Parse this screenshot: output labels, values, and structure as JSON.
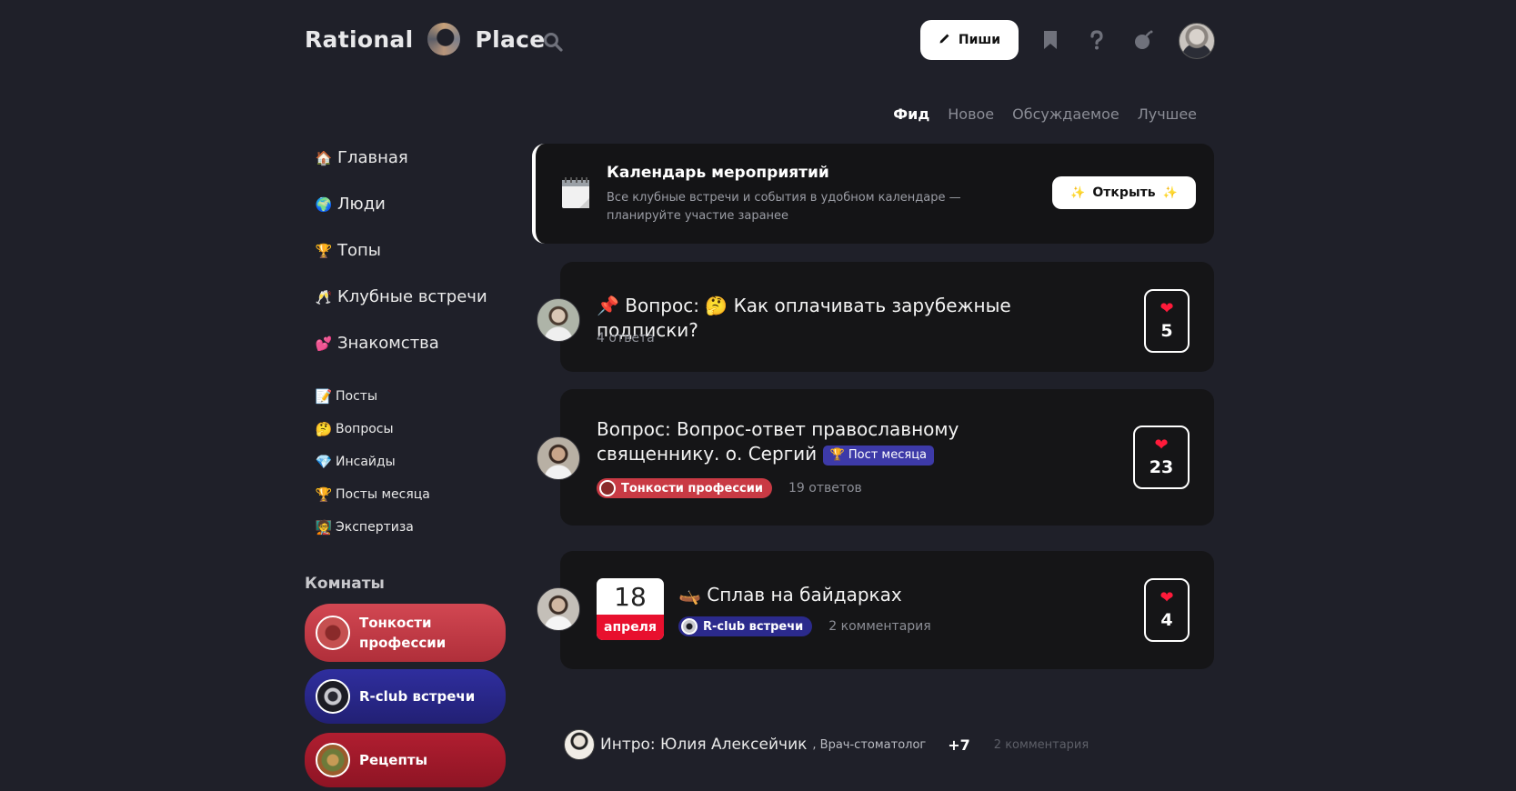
{
  "header": {
    "logo_left": "Rational",
    "logo_right": "Place",
    "write_label": "Пиши",
    "icons": [
      "search-icon",
      "bookmark-icon",
      "help-icon",
      "bomb-icon"
    ]
  },
  "sort_tabs": [
    {
      "label": "Фид",
      "active": true
    },
    {
      "label": "Новое",
      "active": false
    },
    {
      "label": "Обсуждаемое",
      "active": false
    },
    {
      "label": "Лучшее",
      "active": false
    }
  ],
  "nav_main": [
    {
      "emoji": "🏠",
      "label": "Главная"
    },
    {
      "emoji": "🌍",
      "label": "Люди"
    },
    {
      "emoji": "🏆",
      "label": "Топы"
    },
    {
      "emoji": "🥂",
      "label": "Клубные встречи"
    },
    {
      "emoji": "💕",
      "label": "Знакомства"
    }
  ],
  "nav_sub": [
    {
      "emoji": "📝",
      "label": "Посты"
    },
    {
      "emoji": "🤔",
      "label": "Вопросы"
    },
    {
      "emoji": "💎",
      "label": "Инсайды"
    },
    {
      "emoji": "🏆",
      "label": "Посты месяца"
    },
    {
      "emoji": "🧑‍🏫",
      "label": "Экспертиза"
    }
  ],
  "rooms": {
    "title": "Комнаты",
    "items": [
      {
        "label": "Тонкости профессии",
        "color": "#c93a44"
      },
      {
        "label": "R-club встречи",
        "color": "#2b2a8c"
      },
      {
        "label": "Рецепты",
        "color": "#a3182a"
      }
    ]
  },
  "calendar_card": {
    "title": "Календарь мероприятий",
    "description": "Все клубные встречи и события в удобном календаре — планируйте участие заранее",
    "button_label": "Открыть"
  },
  "posts": [
    {
      "title": "📌 Вопрос: 🤔 Как оплачивать зарубежные подписки?",
      "meta": "4 ответа",
      "likes": "5"
    },
    {
      "title": "Вопрос: Вопрос-ответ православному священнику. о. Сергий",
      "badge": "🏆 Пост месяца",
      "room_tag": "Тонкости профессии",
      "meta": "19 ответов",
      "likes": "23"
    },
    {
      "date_day": "18",
      "date_month": "апреля",
      "title": "🛶 Сплав на байдарках",
      "room_tag": "R-club встречи",
      "meta": "2 комментария",
      "likes": "4"
    }
  ],
  "intro": {
    "title": "Интро: Юлия Алексейчик",
    "role": ", Врач-стоматолог",
    "plus": "+7",
    "comments": "2 комментария"
  },
  "colors": {
    "background": "#1f2029",
    "card": "#151517",
    "like_heart": "#ff1a3a",
    "badge_month": "#3d3aa8",
    "date_red": "#e8102e"
  }
}
